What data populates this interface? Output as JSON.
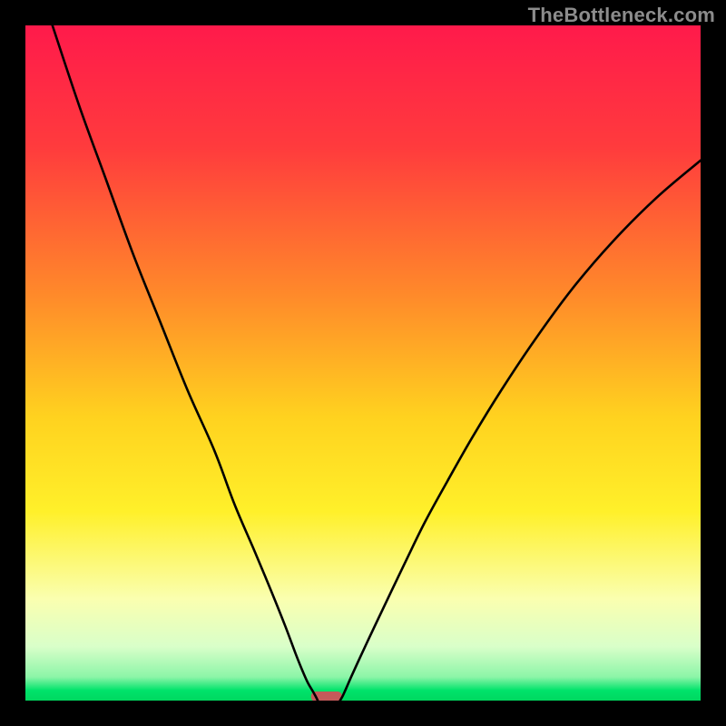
{
  "watermark": "TheBottleneck.com",
  "chart_data": {
    "type": "line",
    "title": "",
    "xlabel": "",
    "ylabel": "",
    "xlim": [
      0,
      100
    ],
    "ylim": [
      0,
      100
    ],
    "gradient_stops": [
      {
        "offset": 0.0,
        "color": "#ff1a4b"
      },
      {
        "offset": 0.18,
        "color": "#ff3b3d"
      },
      {
        "offset": 0.4,
        "color": "#ff8a2a"
      },
      {
        "offset": 0.58,
        "color": "#ffd21f"
      },
      {
        "offset": 0.72,
        "color": "#fff02a"
      },
      {
        "offset": 0.85,
        "color": "#faffb0"
      },
      {
        "offset": 0.92,
        "color": "#d9ffc9"
      },
      {
        "offset": 0.965,
        "color": "#8cf5a8"
      },
      {
        "offset": 0.985,
        "color": "#00e36b"
      },
      {
        "offset": 1.0,
        "color": "#00d85f"
      }
    ],
    "series": [
      {
        "name": "left-branch",
        "x": [
          4,
          8,
          12,
          16,
          20,
          24,
          28,
          31,
          34,
          36.5,
          38.5,
          40,
          41,
          41.8,
          42.5,
          43,
          43.3
        ],
        "y": [
          100,
          88,
          77,
          66,
          56,
          46,
          37,
          29,
          22,
          16,
          11,
          7,
          4.5,
          2.7,
          1.5,
          0.6,
          0
        ]
      },
      {
        "name": "right-branch",
        "x": [
          46.6,
          47,
          47.5,
          48.2,
          49.2,
          50.5,
          52.2,
          54.2,
          56.5,
          59.2,
          62.5,
          66.2,
          70.5,
          75.5,
          81,
          87,
          93.5,
          100
        ],
        "y": [
          0,
          0.7,
          1.8,
          3.4,
          5.6,
          8.4,
          12,
          16.2,
          21,
          26.5,
          32.5,
          39,
          46,
          53.5,
          61,
          68,
          74.5,
          80
        ]
      }
    ],
    "marker": {
      "x": 44.6,
      "width": 4.6,
      "color": "#c55a5a"
    },
    "grid": false
  }
}
